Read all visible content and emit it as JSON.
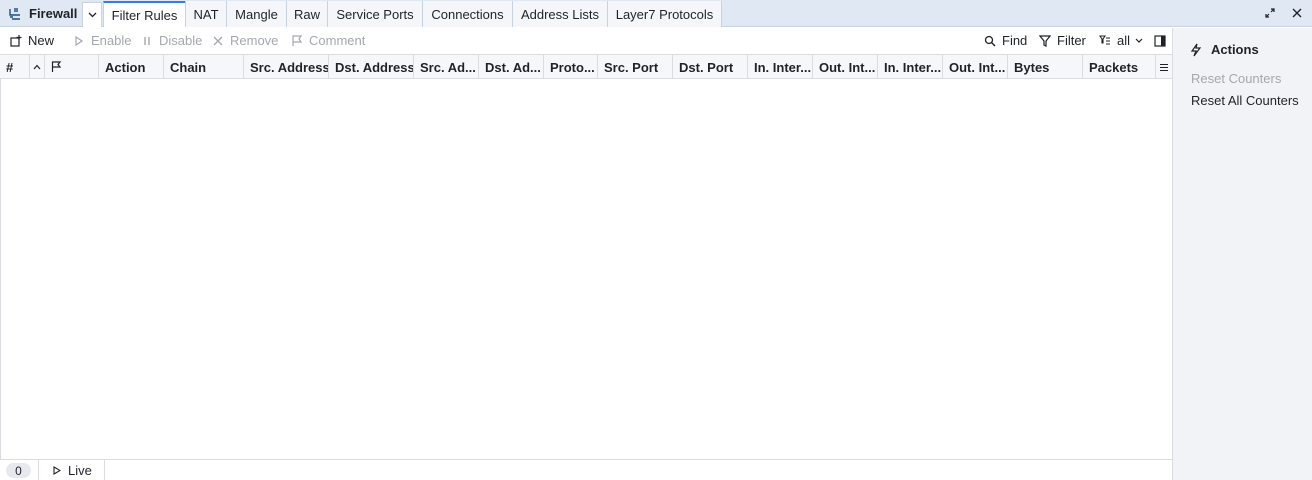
{
  "app": {
    "title": "Firewall",
    "icon": "firewall-icon"
  },
  "tabs": [
    {
      "label": "Filter Rules",
      "active": true
    },
    {
      "label": "NAT",
      "active": false
    },
    {
      "label": "Mangle",
      "active": false
    },
    {
      "label": "Raw",
      "active": false
    },
    {
      "label": "Service Ports",
      "active": false
    },
    {
      "label": "Connections",
      "active": false
    },
    {
      "label": "Address Lists",
      "active": false
    },
    {
      "label": "Layer7 Protocols",
      "active": false
    }
  ],
  "toolbar": {
    "new": "New",
    "enable": "Enable",
    "disable": "Disable",
    "remove": "Remove",
    "comment": "Comment",
    "find": "Find",
    "filter": "Filter",
    "view": "all"
  },
  "columns": [
    "#",
    "",
    "Action",
    "Chain",
    "Src. Address",
    "Dst. Address",
    "Src. Ad...",
    "Dst. Ad...",
    "Proto...",
    "Src. Port",
    "Dst. Port",
    "In. Inter...",
    "Out. Int...",
    "In. Inter...",
    "Out. Int...",
    "Bytes",
    "Packets"
  ],
  "rows": [],
  "status": {
    "count": "0",
    "live": "Live"
  },
  "actions_panel": {
    "title": "Actions",
    "items": [
      {
        "label": "Reset Counters",
        "enabled": false
      },
      {
        "label": "Reset All Counters",
        "enabled": true
      }
    ]
  },
  "colors": {
    "accent": "#2c82d6",
    "tabbar": "#dfe8f3",
    "disabled": "#a3a8af"
  }
}
